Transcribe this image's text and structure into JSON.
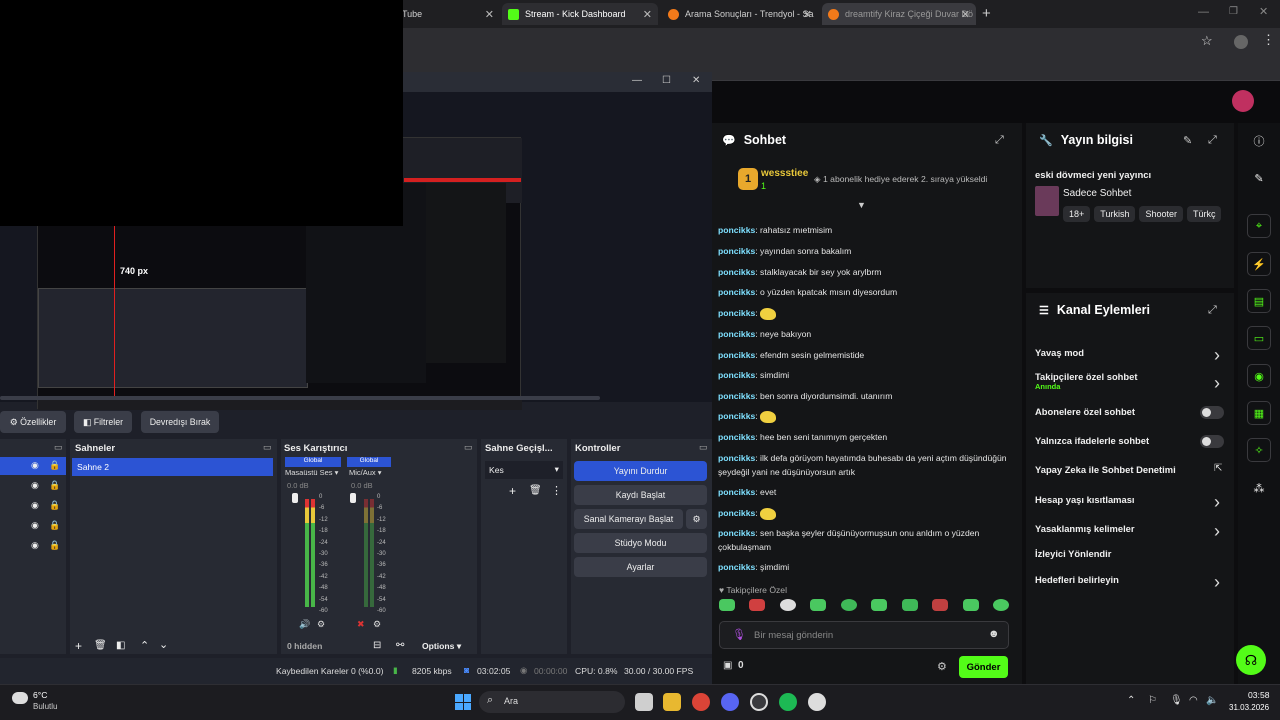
{
  "browser": {
    "tabs": [
      {
        "label": "Tube",
        "active": false
      },
      {
        "label": "Stream - Kick Dashboard",
        "active": true
      },
      {
        "label": "Arama Sonuçları - Trendyol - Sa",
        "active": false
      },
      {
        "label": "dreamtify Kiraz Çiçeği Duvar Dö",
        "active": false
      }
    ],
    "new_tab": "+"
  },
  "chat": {
    "title": "Sohbet",
    "pinned_user": "wessstiee",
    "pinned_badge": "1",
    "pinned_count": "1",
    "pinned_text": "1 abonelik hediye ederek 2. sıraya yükseldi",
    "messages": [
      {
        "user": "poncikks",
        "text": "rahatsız mıetmisim"
      },
      {
        "user": "poncikks",
        "text": "yayından sonra bakalım"
      },
      {
        "user": "poncikks",
        "text": "stalklayacak bir sey yok arylbrm"
      },
      {
        "user": "poncikks",
        "text": "o yüzden kpatcak mısın diyesordum"
      },
      {
        "user": "poncikks",
        "text": "",
        "emote": true
      },
      {
        "user": "poncikks",
        "text": "neye bakıyon"
      },
      {
        "user": "poncikks",
        "text": "efendm sesin gelmemistide"
      },
      {
        "user": "poncikks",
        "text": "simdimi"
      },
      {
        "user": "poncikks",
        "text": "ben sonra diyordumsimdi. utanırım"
      },
      {
        "user": "poncikks",
        "text": "",
        "emote": true
      },
      {
        "user": "poncikks",
        "text": "hee ben seni tanımıym gerçekten"
      },
      {
        "user": "poncikks",
        "text": "ilk defa görüyom hayatımda buhesabı da yeni açtım düşündüğün şeydeğil yani ne düşünüyorsun artık"
      },
      {
        "user": "poncikks",
        "text": "evet"
      },
      {
        "user": "poncikks",
        "text": "",
        "emote": true
      },
      {
        "user": "poncikks",
        "text": "sen başka şeyler düşünüyormuşsun onu anldım o yüzden çokbulaşmam"
      },
      {
        "user": "poncikks",
        "text": "şimdimi"
      }
    ],
    "sep": ": ",
    "followers_only": "Takipçilere Özel",
    "input_placeholder": "Bir mesaj gönderin",
    "points": "0",
    "send_label": "Gönder"
  },
  "stream_info": {
    "title": "Yayın bilgisi",
    "stream_title": "eski dövmeci yeni yayıncı",
    "category": "Sadece Sohbet",
    "tags": [
      "18+",
      "Turkish",
      "Shooter",
      "Türkç"
    ]
  },
  "channel_actions": {
    "title": "Kanal Eylemleri",
    "items": [
      {
        "label": "Yavaş mod",
        "control": "chevron"
      },
      {
        "label": "Takipçilere özel sohbet",
        "sub": "Anında",
        "control": "chevron"
      },
      {
        "label": "Abonelere özel sohbet",
        "control": "toggle"
      },
      {
        "label": "Yalnızca ifadelerle sohbet",
        "control": "toggle"
      },
      {
        "label": "Yapay Zeka ile Sohbet Denetimi",
        "control": "external"
      },
      {
        "label": "Hesap yaşı kısıtlaması",
        "control": "chevron"
      },
      {
        "label": "Yasaklanmış kelimeler",
        "control": "chevron"
      },
      {
        "label": "İzleyici Yönlendir",
        "control": "none"
      },
      {
        "label": "Hedefleri belirleyin",
        "control": "chevron"
      }
    ]
  },
  "obs": {
    "preview_label": "740 px",
    "props_label": "Özellikler",
    "filters_label": "Filtreler",
    "deactivate_label": "Devredışı Bırak",
    "scenes_title": "Sahneler",
    "scene_item": "Sahne 2",
    "mixer_title": "Ses Karıştırıcı",
    "mixer_channels": [
      {
        "tag": "Global",
        "name": "Masaüstü Ses",
        "db": "0.0 dB"
      },
      {
        "tag": "Global",
        "name": "Mic/Aux",
        "db": "0.0 dB"
      }
    ],
    "mixer_scale": [
      "0",
      "-6",
      "-12",
      "-18",
      "-24",
      "-30",
      "-36",
      "-42",
      "-48",
      "-54",
      "-60"
    ],
    "transitions_title": "Sahne Geçişl...",
    "transition_value": "Kes",
    "controls_title": "Kontroller",
    "controls": [
      "Yayını Durdur",
      "Kaydı Başlat",
      "Sanal Kamerayı Başlat",
      "Stüdyo Modu",
      "Ayarlar"
    ],
    "hidden_label": "0 hidden",
    "options_label": "Options",
    "status": {
      "dropped": "Kaybedilen Kareler 0 (%0.0)",
      "bitrate": "8205 kbps",
      "stream_time": "03:02:05",
      "rec_time": "00:00:00",
      "cpu": "CPU: 0.8%",
      "fps": "30.00 / 30.00 FPS"
    }
  },
  "taskbar": {
    "weather_temp": "6°C",
    "weather_desc": "Bulutlu",
    "search": "Ara",
    "time": "03:58",
    "date": "31.03.2026"
  },
  "colors": {
    "kick_green": "#53fc18",
    "obs_blue": "#2c54d4",
    "username": "#7ee0ff"
  }
}
